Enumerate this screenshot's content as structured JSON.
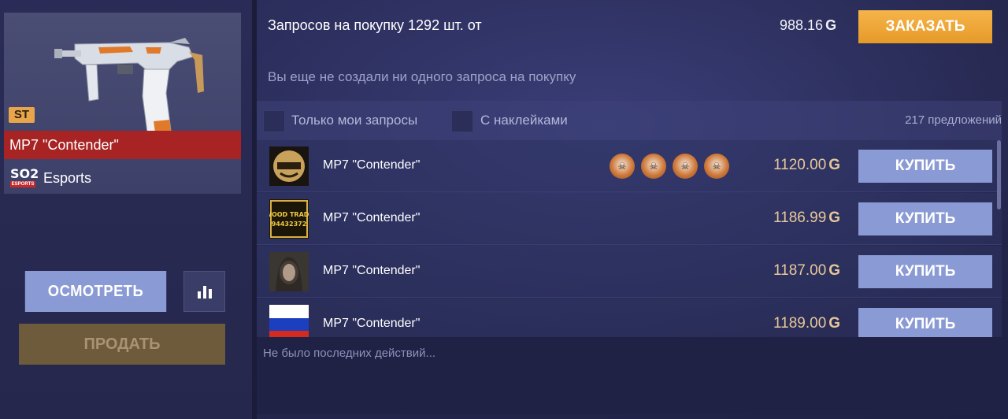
{
  "item": {
    "badge": "ST",
    "name": "MP7 \"Contender\"",
    "collection_logo_top": "SO2",
    "collection_logo_bottom": "ESPORTS",
    "collection": "Esports"
  },
  "actions": {
    "inspect_label": "ОСМОТРЕТЬ",
    "sell_label": "ПРОДАТЬ"
  },
  "requests": {
    "summary": "Запросов на покупку 1292 шт. от",
    "best_price": "988.16",
    "order_label": "ЗАКАЗАТЬ",
    "empty_message": "Вы еще не создали ни одного запроса на покупку"
  },
  "filters": {
    "my_requests_label": "Только мои запросы",
    "with_stickers_label": "С наклейками",
    "offer_count": "217 предложений"
  },
  "currency_symbol": "G",
  "offers": [
    {
      "name": "MP7 \"Contender\"",
      "price": "1120.00",
      "buy_label": "КУПИТЬ",
      "avatar": "helmet-avatar",
      "stickers": 4
    },
    {
      "name": "MP7 \"Contender\"",
      "price": "1186.99",
      "buy_label": "КУПИТЬ",
      "avatar": "trade-avatar",
      "stickers": 0
    },
    {
      "name": "MP7 \"Contender\"",
      "price": "1187.00",
      "buy_label": "КУПИТЬ",
      "avatar": "photo-avatar",
      "stickers": 0
    },
    {
      "name": "MP7 \"Contender\"",
      "price": "1189.00",
      "buy_label": "КУПИТЬ",
      "avatar": "flag-avatar",
      "stickers": 0
    }
  ],
  "avatar_text": {
    "trade_line1": "WOOD TRADE",
    "trade_line2": "94432372"
  },
  "footer": {
    "message": "Не было последних действий..."
  },
  "colors": {
    "accent_orange": "#e69a28",
    "buy_button": "#8a9ad4",
    "name_bar_red": "#a82424",
    "price_gold": "#e8c79a"
  }
}
